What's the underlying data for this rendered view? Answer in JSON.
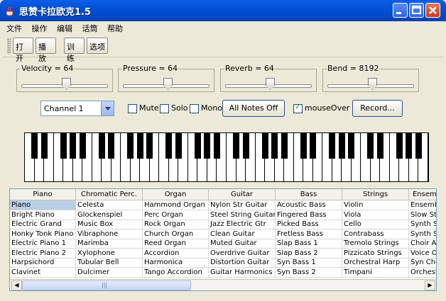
{
  "window": {
    "title": "思赞卡拉欧克1.5"
  },
  "menu": [
    "文件",
    "操作",
    "编辑",
    "话筒",
    "帮助"
  ],
  "toolbar": {
    "open": "打开",
    "play": "播放",
    "train": "训练",
    "options": "选项"
  },
  "sliders": [
    {
      "label": "Velocity = 64",
      "value": 64,
      "max": 127
    },
    {
      "label": "Pressure = 64",
      "value": 64,
      "max": 127
    },
    {
      "label": "Reverb = 64",
      "value": 64,
      "max": 127
    },
    {
      "label": "Bend = 8192",
      "value": 8192,
      "max": 16383
    }
  ],
  "controls": {
    "channel": "Channel 1",
    "mute": "Mute",
    "mute_checked": false,
    "solo": "Solo",
    "solo_checked": false,
    "mono": "Mono",
    "mono_checked": false,
    "all_notes_off": "All Notes Off",
    "mouse_over": "mouseOver",
    "mouse_over_checked": true,
    "record": "Record..."
  },
  "keyboard": {
    "white_keys": 42
  },
  "table": {
    "columns": [
      "Piano",
      "Chromatic Perc.",
      "Organ",
      "Guitar",
      "Bass",
      "Strings",
      "Ensemble"
    ],
    "rows": [
      [
        "Piano",
        "Celesta",
        "Hammond Organ",
        "Nylon Str Guitar",
        "Acoustic Bass",
        "Violin",
        "Ensemble"
      ],
      [
        "Bright Piano",
        "Glockenspiel",
        "Perc Organ",
        "Steel String Guitar",
        "Fingered Bass",
        "Viola",
        "Slow Strings"
      ],
      [
        "Electric Grand",
        "Music Box",
        "Rock Organ",
        "Jazz Electric Gtr",
        "Picked Bass",
        "Cello",
        "Synth Strings"
      ],
      [
        "Honky Tonk Piano",
        "Vibraphone",
        "Church Organ",
        "Clean Guitar",
        "Fretless Bass",
        "Contrabass",
        "Synth Strings"
      ],
      [
        "Electric Piano 1",
        "Marimba",
        "Reed Organ",
        "Muted Guitar",
        "Slap Bass 1",
        "Tremolo Strings",
        "Choir Aahs"
      ],
      [
        "Electric Piano 2",
        "Xylophone",
        "Accordion",
        "Overdrive Guitar",
        "Slap Bass 2",
        "Pizzicato Strings",
        "Voice Oohs"
      ],
      [
        "Harpsichord",
        "Tubular Bell",
        "Harmonica",
        "Distortion Guitar",
        "Syn Bass 1",
        "Orchestral Harp",
        "Syn Choir"
      ],
      [
        "Clavinet",
        "Dulcimer",
        "Tango Accordion",
        "Guitar Harmonics",
        "Syn Bass 2",
        "Timpani",
        "Orchestra Hit"
      ]
    ],
    "selected": [
      0,
      0
    ]
  }
}
